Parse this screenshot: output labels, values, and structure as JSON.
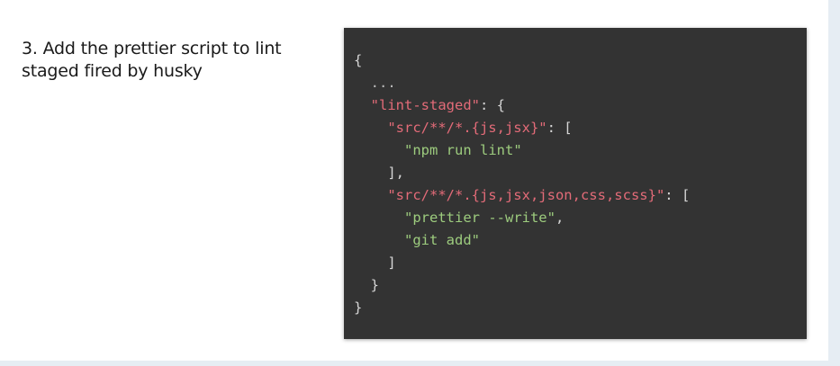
{
  "step": {
    "text": "3. Add the prettier script to lint staged fired by husky"
  },
  "code": {
    "lines": [
      [
        {
          "t": "{",
          "c": "punct"
        }
      ],
      [
        {
          "t": "  ...",
          "c": "ellipsis"
        }
      ],
      [
        {
          "t": "  ",
          "c": "punct"
        },
        {
          "t": "\"lint-staged\"",
          "c": "key"
        },
        {
          "t": ": {",
          "c": "punct"
        }
      ],
      [
        {
          "t": "    ",
          "c": "punct"
        },
        {
          "t": "\"src/**/*.{js,jsx}\"",
          "c": "key"
        },
        {
          "t": ": [",
          "c": "punct"
        }
      ],
      [
        {
          "t": "      ",
          "c": "punct"
        },
        {
          "t": "\"npm run lint\"",
          "c": "str"
        }
      ],
      [
        {
          "t": "    ],",
          "c": "punct"
        }
      ],
      [
        {
          "t": "    ",
          "c": "punct"
        },
        {
          "t": "\"src/**/*.{js,jsx,json,css,scss}\"",
          "c": "key"
        },
        {
          "t": ": [",
          "c": "punct"
        }
      ],
      [
        {
          "t": "      ",
          "c": "punct"
        },
        {
          "t": "\"prettier --write\"",
          "c": "str"
        },
        {
          "t": ",",
          "c": "punct"
        }
      ],
      [
        {
          "t": "      ",
          "c": "punct"
        },
        {
          "t": "\"git add\"",
          "c": "str"
        }
      ],
      [
        {
          "t": "    ]",
          "c": "punct"
        }
      ],
      [
        {
          "t": "  }",
          "c": "punct"
        }
      ],
      [
        {
          "t": "}",
          "c": "punct"
        }
      ]
    ]
  },
  "colors": {
    "panel_background": "#333333",
    "key": "#e36b78",
    "string": "#9dcc7e",
    "punctuation": "#d6d6d6"
  }
}
